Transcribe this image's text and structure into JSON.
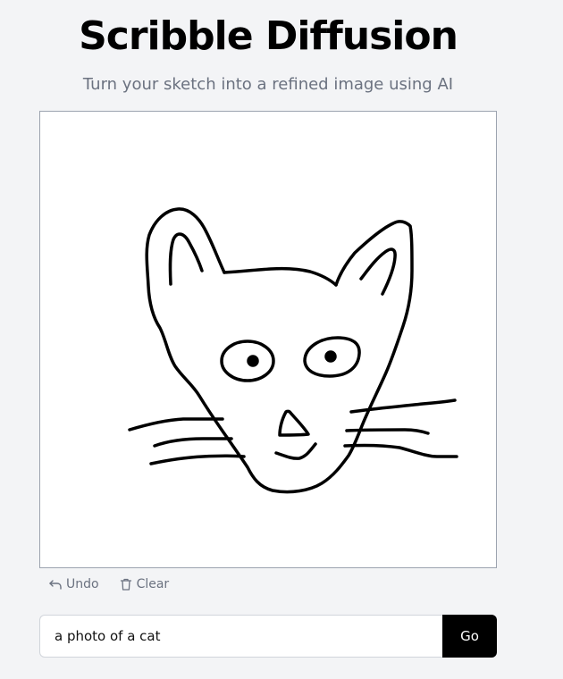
{
  "header": {
    "title": "Scribble Diffusion",
    "subtitle": "Turn your sketch into a refined image using AI"
  },
  "canvas": {
    "drawing_subject": "cat face sketch",
    "stroke_color": "#000000",
    "background_color": "#ffffff"
  },
  "toolbar": {
    "undo_label": "Undo",
    "undo_icon": "undo-arrow-icon",
    "clear_label": "Clear",
    "clear_icon": "trash-icon"
  },
  "prompt": {
    "value": "a photo of a cat",
    "submit_label": "Go"
  },
  "colors": {
    "page_background": "#f3f4f6",
    "title": "#000000",
    "subtitle": "#6b7280",
    "button_background": "#000000",
    "button_text": "#ffffff"
  }
}
